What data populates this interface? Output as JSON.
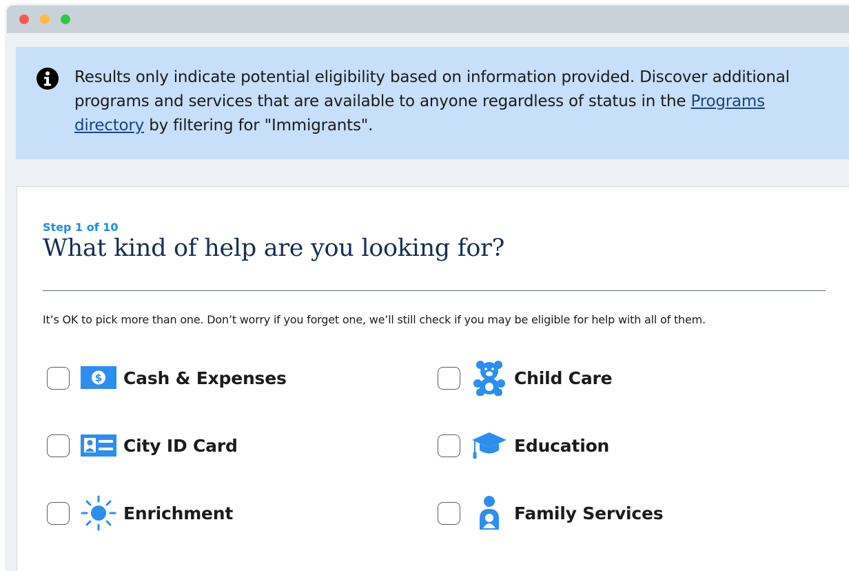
{
  "alert": {
    "icon": "info-circle-icon",
    "text_before": "Results only indicate potential eligibility based on information provided. Discover additional programs and services that are available to anyone regardless of status in the ",
    "link_text": "Programs directory",
    "text_after": " by filtering for \"Immigrants\"."
  },
  "form": {
    "step": "Step 1 of 10",
    "title": "What kind of help are you looking for?",
    "hint": "It’s OK to pick more than one. Don’t worry if you forget one, we’ll still check if you may be eligible for help with all of them.",
    "options": [
      {
        "label": "Cash & Expenses",
        "icon": "dollar-sign-icon",
        "checked": false
      },
      {
        "label": "Child Care",
        "icon": "teddy-bear-icon",
        "checked": false
      },
      {
        "label": "City ID Card",
        "icon": "id-card-icon",
        "checked": false
      },
      {
        "label": "Education",
        "icon": "graduation-cap-icon",
        "checked": false
      },
      {
        "label": "Enrichment",
        "icon": "sun-icon",
        "checked": false
      },
      {
        "label": "Family Services",
        "icon": "parent-child-icon",
        "checked": false
      }
    ]
  },
  "colors": {
    "alert_bg": "#c7dff8",
    "accent": "#1a8ee0",
    "icon_blue": "#2b8ef0",
    "title": "#162e51"
  }
}
